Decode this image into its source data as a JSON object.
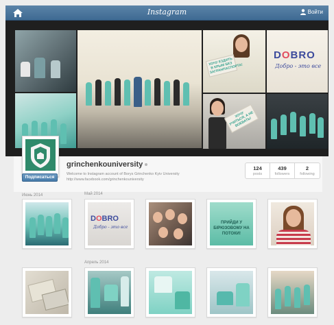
{
  "topbar": {
    "brand": "Instagram",
    "login_label": "Войти",
    "home_icon": "home-icon",
    "user_icon": "user-icon",
    "colors": {
      "bar": "#3e6a93"
    }
  },
  "banner": {
    "sign_1": "ХОЧУ ЕЗДИТЬ В КРЫМ БЕЗ ЗАГРАНПАСПОРТА!",
    "sign_2": "ХОЧУ УЧИТЬСЯ, А НЕ ВОЕВАТЬ!",
    "dobro": {
      "part1": "D",
      "part2": "O",
      "part3": "BRO"
    },
    "dobro_sub": "Добро - это все"
  },
  "profile": {
    "username": "grinchenkouniversity",
    "follow_label": "Подписаться",
    "bio": "Welcome to Instagram account of Borys Grinchenko Kyiv University",
    "url": "http://www.facebook.com/grinchenkouniversity",
    "stats": [
      {
        "value": "124",
        "label": "posts"
      },
      {
        "value": "439",
        "label": "followers"
      },
      {
        "value": "2",
        "label": "following"
      }
    ],
    "colors": {
      "follow_button": "#467aa8"
    }
  },
  "feed": {
    "months": [
      {
        "label": "Июнь 2014"
      },
      {
        "label": "Май 2014"
      },
      {
        "label": "Апрель 2014"
      }
    ],
    "photo_texts": {
      "dobro_sub": "Добро - это все",
      "card_text": "ПРИЙДИ У БІРЮЗОВОМУ НА ПОТОКИ!"
    }
  }
}
